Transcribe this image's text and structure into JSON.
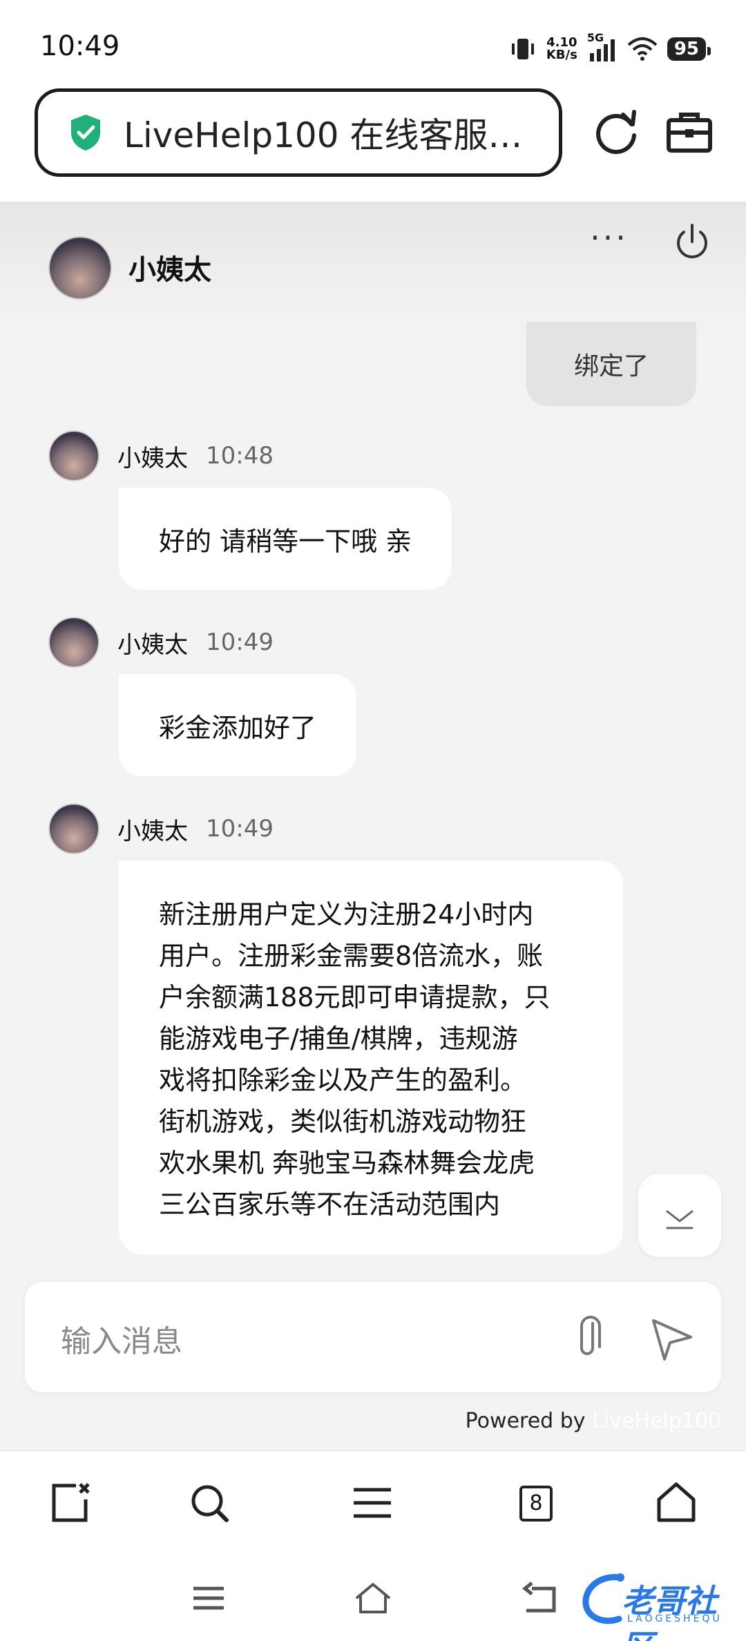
{
  "status_bar": {
    "time": "10:49",
    "net_speed_value": "4.10",
    "net_speed_unit": "KB/s",
    "network": "5G",
    "battery": "95"
  },
  "browser": {
    "url_title": "LiveHelp100 在线客服…",
    "tab_count": "8"
  },
  "chat": {
    "agent_name": "小姨太",
    "user_partial_message": "绑定了",
    "messages": [
      {
        "name": "小姨太",
        "time": "10:48",
        "text": "好的 请稍等一下哦 亲"
      },
      {
        "name": "小姨太",
        "time": "10:49",
        "text": "彩金添加好了"
      },
      {
        "name": "小姨太",
        "time": "10:49",
        "lines": [
          "新注册用户定义为注册24小时内",
          "用户。注册彩金需要8倍流水，账",
          "户余额满188元即可申请提款，只",
          "能游戏电子/捕鱼/棋牌，违规游",
          "戏将扣除彩金以及产生的盈利。",
          "街机游戏，类似街机游戏动物狂",
          "欢水果机 奔驰宝马森林舞会龙虎",
          "三公百家乐等不在活动范围内"
        ]
      }
    ]
  },
  "input": {
    "placeholder": "输入消息"
  },
  "footer": {
    "powered_by": "Powered by ",
    "brand": "LiveHelp100"
  },
  "watermark": {
    "text": "老哥社区",
    "sub": "LAOGESHEQU"
  },
  "colors": {
    "shield_green": "#21b07a",
    "watermark_blue": "#2a79e8"
  }
}
